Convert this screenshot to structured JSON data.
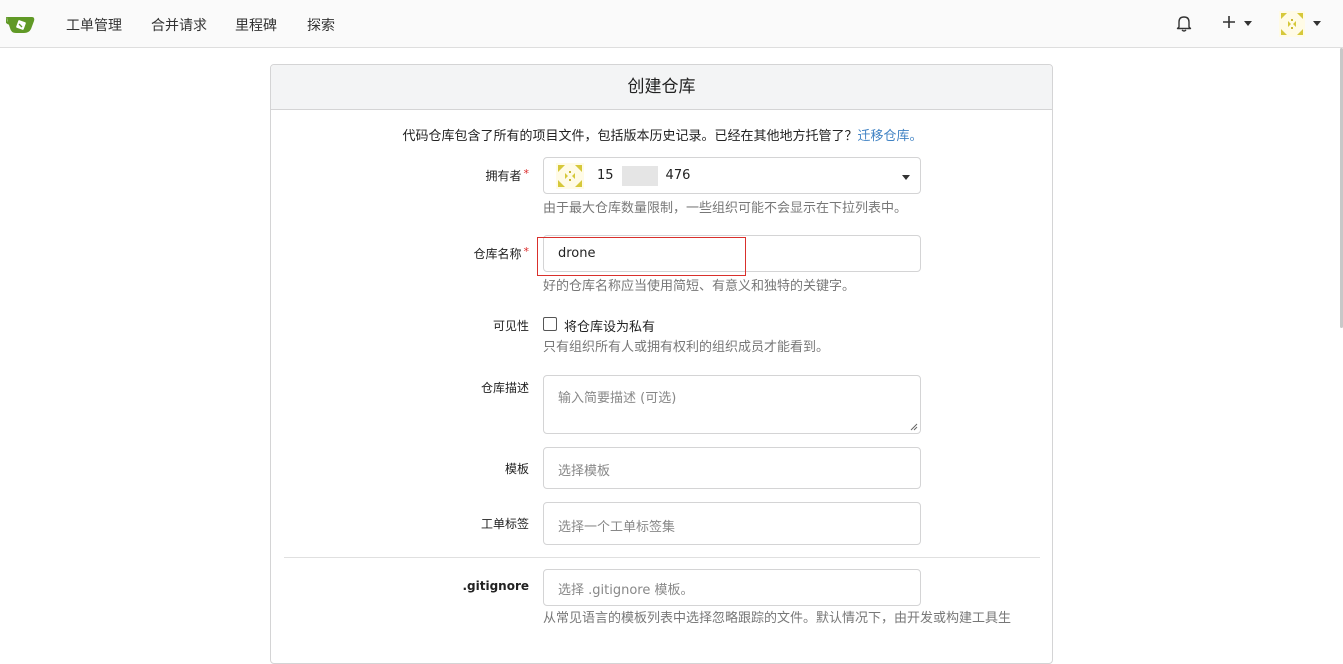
{
  "nav": {
    "items": [
      "工单管理",
      "合并请求",
      "里程碑",
      "探索"
    ]
  },
  "panel": {
    "title": "创建仓库",
    "intro_text": "代码仓库包含了所有的项目文件，包括版本历史记录。已经在其他地方托管了？",
    "intro_link": "迁移仓库。"
  },
  "form": {
    "owner": {
      "label": "拥有者",
      "value_prefix": "15",
      "value_suffix": "476",
      "help": "由于最大仓库数量限制，一些组织可能不会显示在下拉列表中。"
    },
    "repo_name": {
      "label": "仓库名称",
      "value": "drone",
      "help": "好的仓库名称应当使用简短、有意义和独特的关键字。"
    },
    "visibility": {
      "label": "可见性",
      "checkbox_label": "将仓库设为私有",
      "checked": false,
      "help": "只有组织所有人或拥有权利的组织成员才能看到。"
    },
    "description": {
      "label": "仓库描述",
      "placeholder": "输入简要描述 (可选)"
    },
    "template": {
      "label": "模板",
      "placeholder": "选择模板"
    },
    "issue_labels": {
      "label": "工单标签",
      "placeholder": "选择一个工单标签集"
    },
    "gitignore": {
      "label": ".gitignore",
      "placeholder": "选择 .gitignore 模板。",
      "help": "从常见语言的模板列表中选择忽略跟踪的文件。默认情况下，由开发或构建工具生"
    }
  },
  "colors": {
    "logo_green": "#609926",
    "link": "#4183c4",
    "required": "#db2828",
    "highlight_border": "#d9302c"
  },
  "icons": {
    "bell": "bell-icon",
    "plus": "plus-icon",
    "avatar": "avatar"
  }
}
